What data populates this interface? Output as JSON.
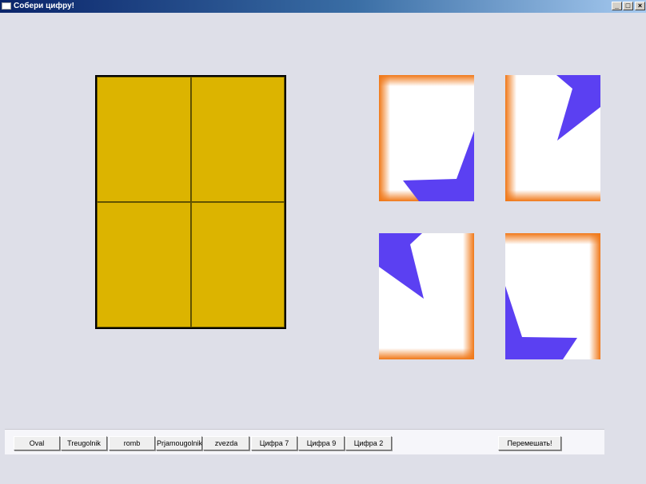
{
  "window": {
    "title": "Собери цифру!",
    "background": "#dedfe8",
    "title_gradient": [
      "#0a246a",
      "#3a6ea5",
      "#a6caf0"
    ]
  },
  "caption_buttons": {
    "minimize_glyph": "_",
    "maximize_glyph": "□",
    "close_glyph": "×"
  },
  "board": {
    "rows": 2,
    "cols": 2,
    "cell_color": "#dcb400",
    "border_color": "#000000"
  },
  "pieces": {
    "fill_color": "#5b40f2",
    "frame_color": "#f07818",
    "count": 4
  },
  "toolbar": {
    "buttons": [
      {
        "id": "oval",
        "label": "Oval"
      },
      {
        "id": "treugolnik",
        "label": "Treugolnik"
      },
      {
        "id": "romb",
        "label": "romb"
      },
      {
        "id": "prjamougolnik",
        "label": "Prjamougolnik"
      },
      {
        "id": "zvezda",
        "label": "zvezda"
      },
      {
        "id": "cifra-7",
        "label": "Цифра 7"
      },
      {
        "id": "cifra-9",
        "label": "Цифра 9"
      },
      {
        "id": "cifra-2",
        "label": "Цифра 2"
      }
    ],
    "shuffle_label": "Перемешать!"
  }
}
